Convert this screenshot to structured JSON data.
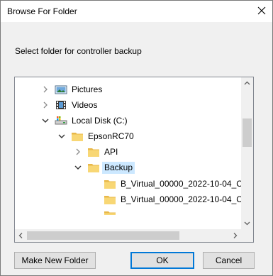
{
  "window": {
    "title": "Browse For Folder",
    "close_icon": "close-icon"
  },
  "prompt": "Select folder for controller backup",
  "tree": {
    "items": [
      {
        "label": "Pictures",
        "icon": "pictures-folder-icon",
        "expander": "collapsed"
      },
      {
        "label": "Videos",
        "icon": "videos-folder-icon",
        "expander": "collapsed"
      },
      {
        "label": "Local Disk (C:)",
        "icon": "drive-icon",
        "expander": "expanded"
      },
      {
        "label": "EpsonRC70",
        "icon": "folder-icon",
        "expander": "expanded"
      },
      {
        "label": "API",
        "icon": "folder-icon",
        "expander": "collapsed"
      },
      {
        "label": "Backup",
        "icon": "folder-icon",
        "expander": "expanded",
        "selected": true
      },
      {
        "label": "B_Virtual_00000_2022-10-04_C",
        "icon": "folder-icon",
        "expander": "none"
      },
      {
        "label": "B_Virtual_00000_2022-10-04_C",
        "icon": "folder-icon",
        "expander": "none"
      }
    ]
  },
  "buttons": {
    "make_new_folder": "Make New Folder",
    "ok": "OK",
    "cancel": "Cancel"
  },
  "colors": {
    "selection": "#cce8ff",
    "default_button_border": "#0078d7",
    "folder": "#f8d775"
  }
}
